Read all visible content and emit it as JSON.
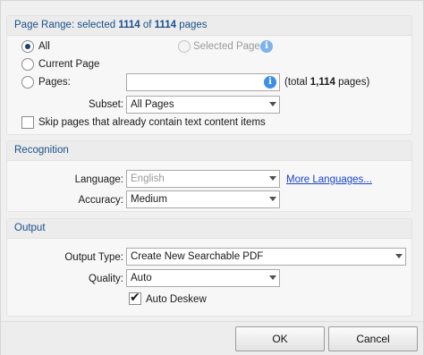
{
  "page_range": {
    "header_prefix": "Page Range: selected ",
    "selected_count": "1114",
    "header_of": " of ",
    "total_count": "1114",
    "header_suffix": " pages",
    "radio_all": "All",
    "radio_selected_pages": "Selected Pages",
    "radio_current_page": "Current Page",
    "radio_pages": "Pages:",
    "pages_input_value": "",
    "total_prefix": "(total ",
    "total_bold": "1,114",
    "total_suffix": " pages)",
    "subset_label": "Subset:",
    "subset_value": "All Pages",
    "skip_label": "Skip pages that already contain text content items"
  },
  "recognition": {
    "header": "Recognition",
    "language_label": "Language:",
    "language_value": "English",
    "more_languages": "More Languages...",
    "accuracy_label": "Accuracy:",
    "accuracy_value": "Medium"
  },
  "output": {
    "header": "Output",
    "output_type_label": "Output Type:",
    "output_type_value": "Create New Searchable PDF",
    "quality_label": "Quality:",
    "quality_value": "Auto",
    "auto_deskew_label": "Auto Deskew"
  },
  "buttons": {
    "ok": "OK",
    "cancel": "Cancel"
  },
  "icons": {
    "info": "i"
  }
}
